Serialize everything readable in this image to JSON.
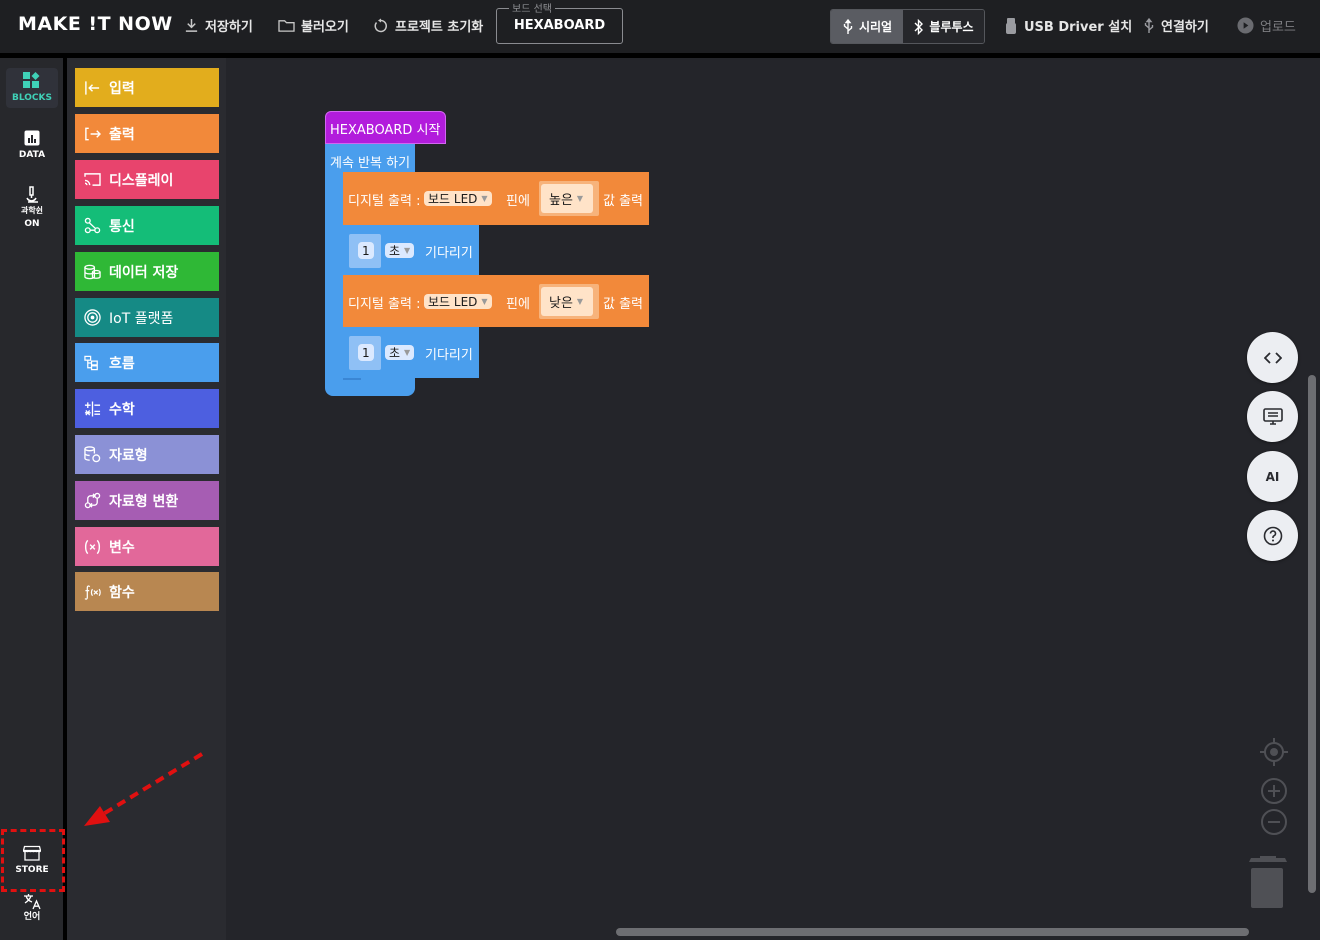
{
  "app": {
    "logo": "MAKE !T NOW"
  },
  "toolbar": {
    "save_label": "저장하기",
    "load_label": "불러오기",
    "reset_label": "프로젝트 초기화",
    "board_legend": "보드 선택",
    "board_value": "HEXABOARD",
    "serial_label": "시리얼",
    "bluetooth_label": "블루투스",
    "usb_driver_label": "USB Driver 설치",
    "connect_label": "연결하기",
    "upload_label": "업로드"
  },
  "sidebar": {
    "items": [
      {
        "label": "BLOCKS",
        "icon": "blocks-icon",
        "active": true
      },
      {
        "label": "DATA",
        "icon": "data-icon",
        "active": false
      },
      {
        "label": "과학쉰",
        "sublabel": "ON",
        "icon": "microscope-icon",
        "active": false
      },
      {
        "label": "STORE",
        "icon": "store-icon",
        "active": false
      },
      {
        "label": "언어",
        "icon": "translate-icon",
        "active": false
      }
    ]
  },
  "categories": [
    {
      "label": "입력",
      "icon": "input-icon",
      "color": "#e2ad1d"
    },
    {
      "label": "출력",
      "icon": "output-icon",
      "color": "#f2893a"
    },
    {
      "label": "디스플레이",
      "icon": "display-icon",
      "color": "#e8446d"
    },
    {
      "label": "통신",
      "icon": "communication-icon",
      "color": "#14bd78"
    },
    {
      "label": "데이터 저장",
      "icon": "database-icon",
      "color": "#2fb836"
    },
    {
      "label": "IoT 플랫폼",
      "icon": "iot-icon",
      "color": "#158a85"
    },
    {
      "label": "흐름",
      "icon": "flow-icon",
      "color": "#4a9eed"
    },
    {
      "label": "수학",
      "icon": "math-icon",
      "color": "#4d5fe0"
    },
    {
      "label": "자료형",
      "icon": "datatype-icon",
      "color": "#8b91d6"
    },
    {
      "label": "자료형 변환",
      "icon": "convert-icon",
      "color": "#a65db3"
    },
    {
      "label": "변수",
      "icon": "variable-icon",
      "color": "#e2689a"
    },
    {
      "label": "함수",
      "icon": "function-icon",
      "color": "#b88751"
    }
  ],
  "program": {
    "start_block": "HEXABOARD 시작",
    "loop_block": "계속 반복 하기",
    "statements": [
      {
        "type": "digital_write",
        "prefix": "디지털 출력 :",
        "pin": "보드 LED",
        "mid": "핀에",
        "value": "높은",
        "suffix": "값 출력"
      },
      {
        "type": "wait",
        "amount": "1",
        "unit": "초",
        "suffix": "기다리기"
      },
      {
        "type": "digital_write",
        "prefix": "디지털 출력 :",
        "pin": "보드 LED",
        "mid": "핀에",
        "value": "낮은",
        "suffix": "값 출력"
      },
      {
        "type": "wait",
        "amount": "1",
        "unit": "초",
        "suffix": "기다리기"
      }
    ]
  },
  "right_tools": {
    "code_icon": "code-icon",
    "monitor_icon": "serial-monitor-icon",
    "ai_label": "AI",
    "help_icon": "help-icon"
  },
  "colors": {
    "start_block": "#b21cdc",
    "loop_block": "#4a9eed",
    "output_block": "#f2893a",
    "highlight": "#e01010"
  }
}
